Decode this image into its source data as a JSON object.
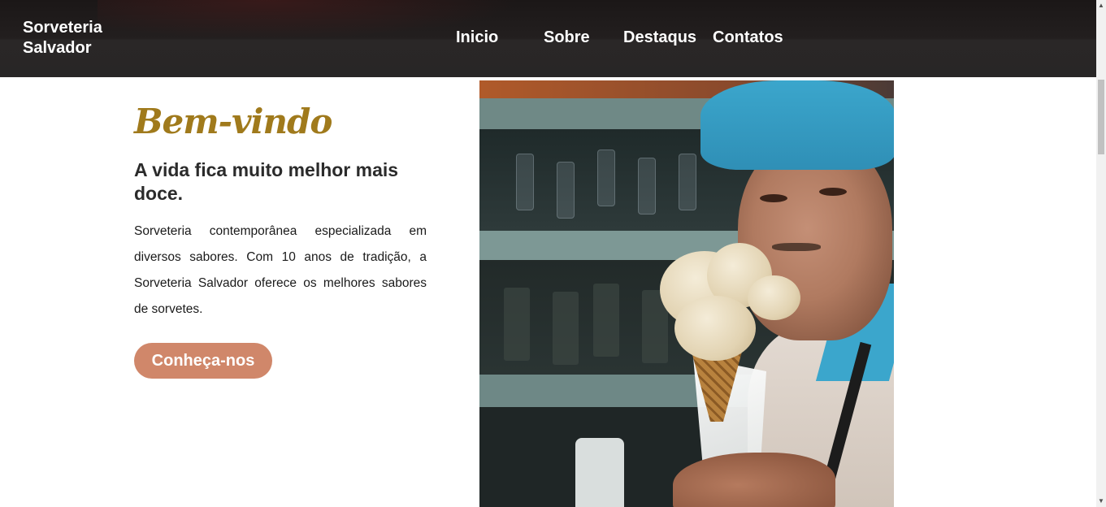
{
  "header": {
    "brand_line1": "Sorveteria",
    "brand_line2": "Salvador",
    "nav": [
      {
        "label": "Inicio"
      },
      {
        "label": "Sobre"
      },
      {
        "label": "Destaqus"
      },
      {
        "label": "Contatos"
      }
    ]
  },
  "hero": {
    "welcome": "Bem-vindo",
    "subtitle": "A vida fica muito melhor mais doce.",
    "description": "Sorveteria contemporânea especializada em diversos sabores. Com 10 anos de tradição, a Sorveteria Salvador oferece os melhores sabores de sorvetes.",
    "cta_label": "Conheça-nos"
  },
  "colors": {
    "navbar": "#231f1f",
    "welcome_gold": "#a07a1c",
    "cta_button": "#d0876a"
  }
}
